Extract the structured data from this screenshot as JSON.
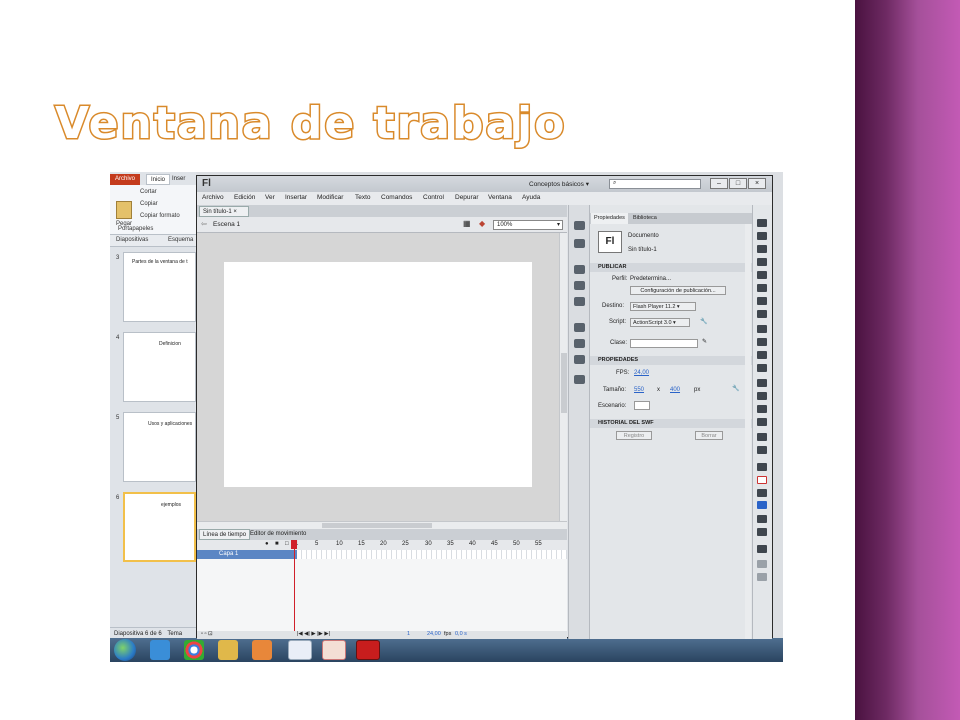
{
  "slide": {
    "title": "Ventana de trabajo"
  },
  "colors": {
    "title_stroke": "#d98a2b",
    "side_band": "#6e2a63",
    "powerpoint_file": "#c43b1d",
    "playhead": "#d0202a",
    "layer_selected": "#5b86c4"
  },
  "powerpoint": {
    "file_tab": "Archivo",
    "tab_home": "Inicio",
    "tab_insert": "Inser",
    "paste": "Pegar",
    "cut": "Cortar",
    "copy": "Copiar",
    "copy_format": "Copiar formato",
    "clipboard_group": "Portapapeles",
    "pane_tab_slides": "Diapositivas",
    "pane_tab_outline": "Esquema",
    "slides": [
      {
        "num": "3",
        "text": "Partes de la ventana de t"
      },
      {
        "num": "4",
        "text": "Definicion"
      },
      {
        "num": "5",
        "text": "Usos y aplicaciones"
      },
      {
        "num": "6",
        "text": "ejemplos"
      }
    ],
    "status": "Diapositiva 6 de 6",
    "status_theme": "Tema"
  },
  "flash": {
    "logo": "Fl",
    "workspace": "Conceptos básicos",
    "menu": [
      "Archivo",
      "Edición",
      "Ver",
      "Insertar",
      "Modificar",
      "Texto",
      "Comandos",
      "Control",
      "Depurar",
      "Ventana",
      "Ayuda"
    ],
    "doc_tab": "Sin título-1",
    "scene": "Escena 1",
    "zoom": "100%",
    "timeline_tabs": [
      "Línea de tiempo",
      "Editor de movimiento"
    ],
    "frame_numbers": [
      "1",
      "5",
      "10",
      "15",
      "20",
      "25",
      "30",
      "35",
      "40",
      "45",
      "50",
      "55"
    ],
    "layer_name": "Capa 1",
    "timeline_fps": "24,00",
    "timeline_fps_unit": "fps",
    "timeline_time": "0,0 s",
    "timeline_frame": "1",
    "properties": {
      "tabs": [
        "Propiedades",
        "Biblioteca"
      ],
      "doc_label": "Documento",
      "doc_name": "Sin título-1",
      "section_publish": "PUBLICAR",
      "profile_label": "Perfil:",
      "profile_value": "Predetermina...",
      "publish_settings": "Configuración de publicación...",
      "target_label": "Destino:",
      "target_value": "Flash Player 11.2",
      "script_label": "Script:",
      "script_value": "ActionScript 3.0",
      "class_label": "Clase:",
      "section_props": "PROPIEDADES",
      "fps_label": "FPS:",
      "fps_value": "24,00",
      "size_label": "Tamaño:",
      "width": "550",
      "x": "x",
      "height": "400",
      "px": "px",
      "stage_label": "Escenario:",
      "section_history": "HISTORIAL DEL SWF",
      "log_button": "Registro",
      "clear_button": "Borrar"
    }
  },
  "taskbar": {
    "icons": [
      "start-orb",
      "internet-explorer",
      "chrome",
      "explorer",
      "media-player",
      "word",
      "powerpoint",
      "flash"
    ]
  }
}
